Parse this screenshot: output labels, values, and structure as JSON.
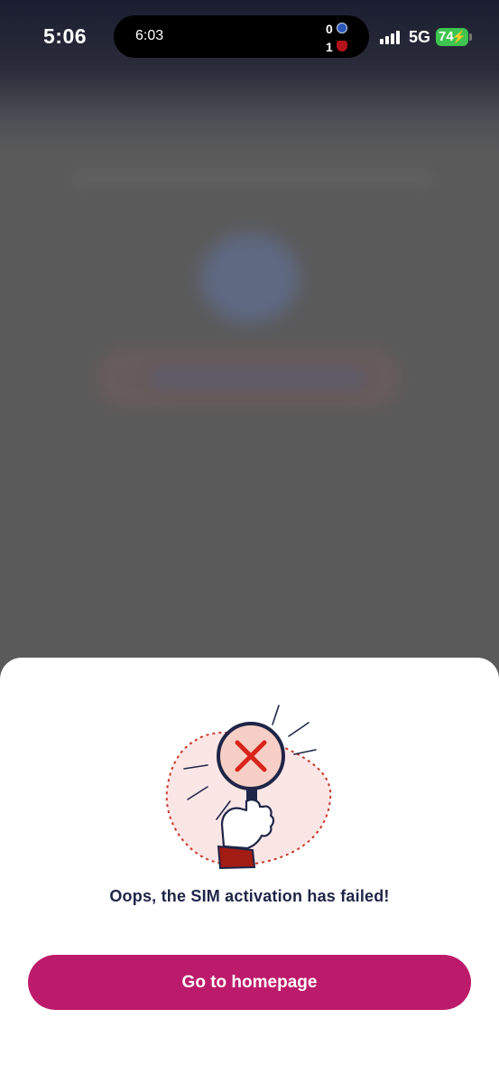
{
  "status_bar": {
    "time": "5:06",
    "live_activity": {
      "time": "6:03",
      "home_score": "0",
      "away_score": "1",
      "home_crest_icon": "chelsea-crest-icon",
      "away_crest_icon": "team-crest-icon"
    },
    "network": "5G",
    "battery": "74",
    "battery_color": "#3ec450",
    "charging_icon": "bolt-icon",
    "signal_icon": "cellular-signal-icon"
  },
  "sheet": {
    "illustration_icon": "magnifier-error-icon",
    "message": "Oops, the SIM activation has failed!",
    "button_label": "Go to homepage",
    "button_color": "#bc1a6a",
    "text_color": "#1f2547"
  }
}
